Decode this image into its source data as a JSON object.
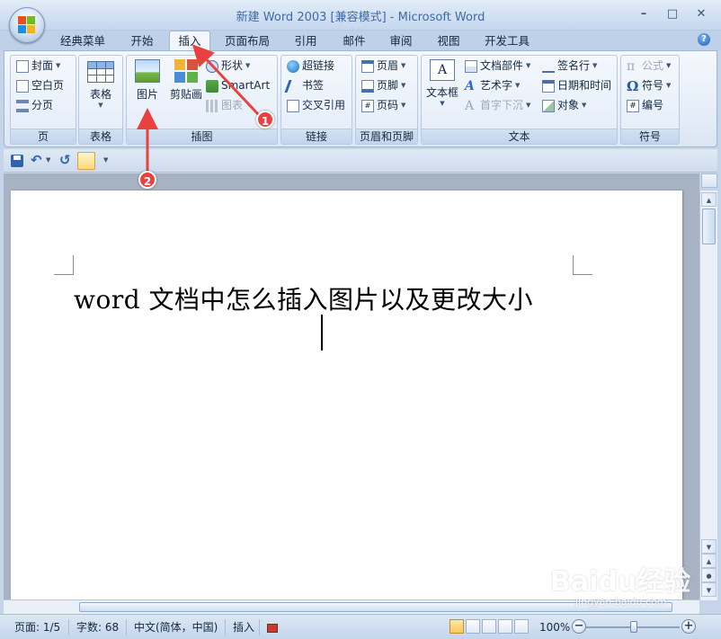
{
  "window": {
    "title": "新建 Word 2003 [兼容模式] - Microsoft Word",
    "minimize": "–",
    "maximize": "□",
    "close": "✕"
  },
  "tabs": [
    {
      "label": "经典菜单",
      "active": false
    },
    {
      "label": "开始",
      "active": false
    },
    {
      "label": "插入",
      "active": true
    },
    {
      "label": "页面布局",
      "active": false
    },
    {
      "label": "引用",
      "active": false
    },
    {
      "label": "邮件",
      "active": false
    },
    {
      "label": "审阅",
      "active": false
    },
    {
      "label": "视图",
      "active": false
    },
    {
      "label": "开发工具",
      "active": false
    }
  ],
  "help_icon": "help-icon",
  "ribbon": {
    "pages": {
      "label": "页",
      "cover": "封面",
      "blank_page": "空白页",
      "page_break": "分页"
    },
    "tables": {
      "label": "表格",
      "table": "表格"
    },
    "illustrations": {
      "label": "插图",
      "picture": "图片",
      "clipart": "剪贴画",
      "shapes": "形状",
      "smartart": "SmartArt",
      "chart": "图表"
    },
    "links": {
      "label": "链接",
      "hyperlink": "超链接",
      "bookmark": "书签",
      "cross_ref": "交叉引用"
    },
    "header_footer": {
      "label": "页眉和页脚",
      "header": "页眉",
      "footer": "页脚",
      "page_number": "页码"
    },
    "text": {
      "label": "文本",
      "textbox": "文本框",
      "quick_parts": "文档部件",
      "wordart": "艺术字",
      "drop_cap": "首字下沉",
      "signature_line": "签名行",
      "date_time": "日期和时间",
      "object": "对象"
    },
    "symbols": {
      "label": "符号",
      "equation": "公式",
      "symbol": "符号",
      "number": "编号"
    }
  },
  "qat": {
    "items": [
      "save-icon",
      "undo-icon",
      "redo-icon",
      "format-painter-icon",
      "customize-icon"
    ]
  },
  "document": {
    "text": "word 文档中怎么插入图片以及更改大小"
  },
  "status": {
    "page": "页面: 1/5",
    "words": "字数: 68",
    "language": "中文(简体，中国)",
    "mode": "插入",
    "zoom": "100%",
    "zoom_level": 100
  },
  "annotations": {
    "badge1": "1",
    "badge2": "2"
  },
  "watermark": {
    "logo": "Baidu经验",
    "url": "jingyan.baidu.com"
  },
  "colors": {
    "accent": "#3e6aa6",
    "annotation": "#e8413f",
    "ribbon_bg": "#dbe6f4"
  }
}
